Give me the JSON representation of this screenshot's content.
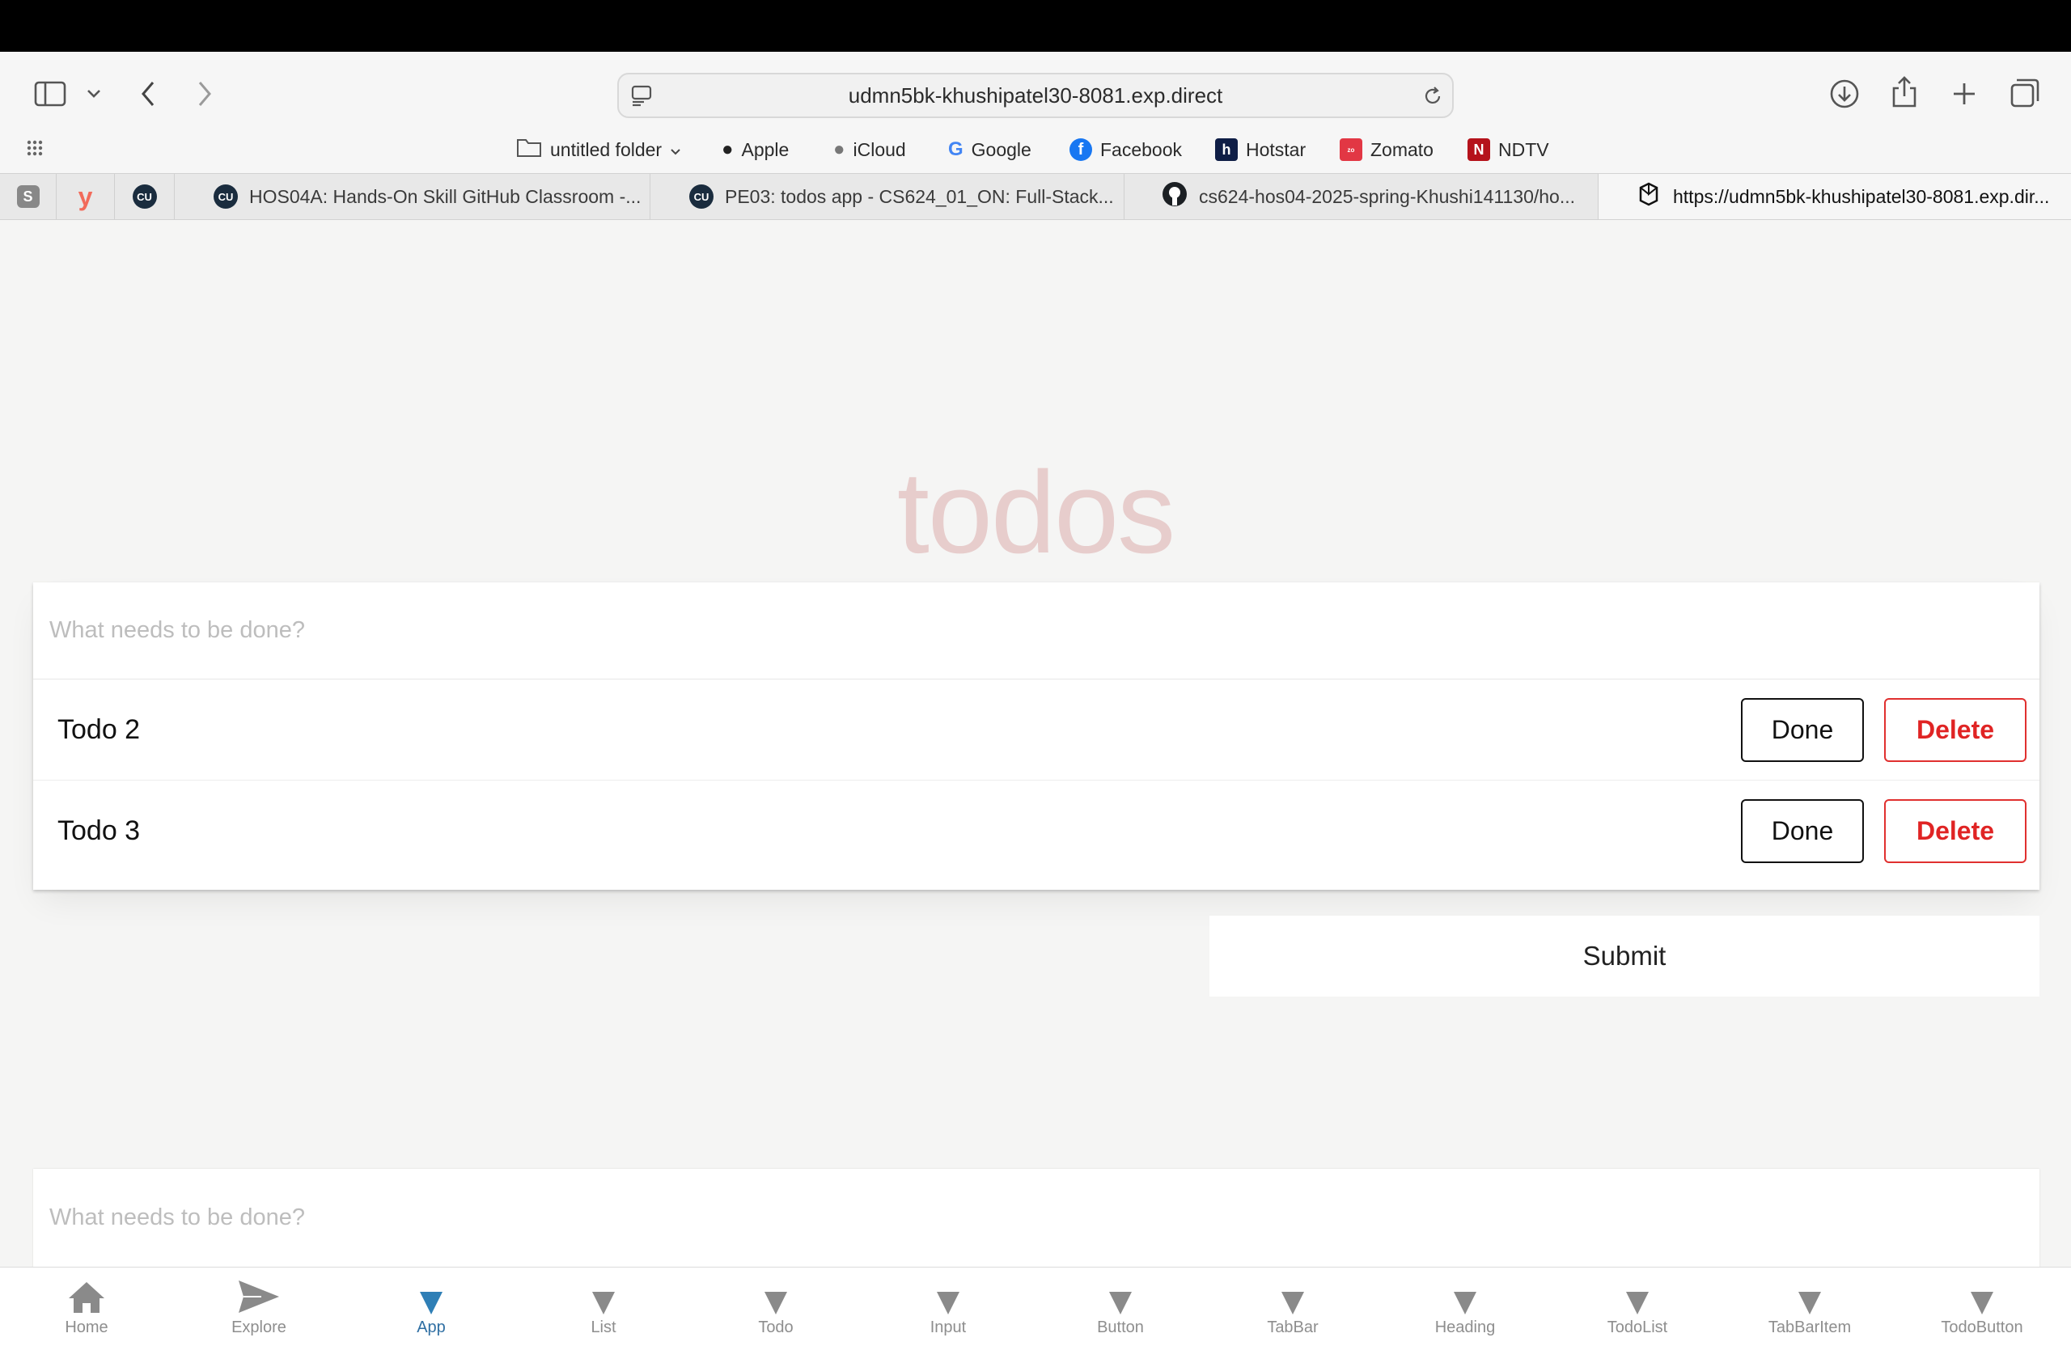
{
  "browser": {
    "url": "udmn5bk-khushipatel30-8081.exp.direct",
    "bookmarks": [
      {
        "label": "untitled folder",
        "icon": "folder-icon"
      },
      {
        "label": "Apple",
        "icon": "apple-icon"
      },
      {
        "label": "iCloud",
        "icon": "apple-icon"
      },
      {
        "label": "Google",
        "icon": "google-icon"
      },
      {
        "label": "Facebook",
        "icon": "facebook-icon"
      },
      {
        "label": "Hotstar",
        "icon": "hotstar-icon"
      },
      {
        "label": "Zomato",
        "icon": "zomato-icon"
      },
      {
        "label": "NDTV",
        "icon": "ndtv-icon"
      }
    ],
    "pinned_tabs": [
      {
        "label": "S"
      },
      {
        "icon": "yc-icon"
      },
      {
        "label": "CU"
      }
    ],
    "tabs": [
      {
        "title": "HOS04A: Hands-On Skill GitHub Classroom -...",
        "icon_label": "CU"
      },
      {
        "title": "PE03: todos app - CS624_01_ON: Full-Stack...",
        "icon_label": "CU"
      },
      {
        "title": "cs624-hos04-2025-spring-Khushi141130/ho...",
        "icon": "github-icon"
      },
      {
        "title": "https://udmn5bk-khushipatel30-8081.exp.dir...",
        "icon": "expo-icon",
        "active": true
      }
    ]
  },
  "app": {
    "title": "todos",
    "input_placeholder": "What needs to be done?",
    "todos": [
      {
        "text": "Todo 2",
        "done_label": "Done",
        "delete_label": "Delete"
      },
      {
        "text": "Todo 3",
        "done_label": "Done",
        "delete_label": "Delete"
      }
    ],
    "submit_label": "Submit",
    "second_input_placeholder": "What needs to be done?"
  },
  "tabbar": {
    "items": [
      {
        "label": "Home",
        "icon": "home-icon"
      },
      {
        "label": "Explore",
        "icon": "send-icon"
      },
      {
        "label": "App",
        "icon": "triangle-down-icon",
        "active": true
      },
      {
        "label": "List",
        "icon": "triangle-down-icon"
      },
      {
        "label": "Todo",
        "icon": "triangle-down-icon"
      },
      {
        "label": "Input",
        "icon": "triangle-down-icon"
      },
      {
        "label": "Button",
        "icon": "triangle-down-icon"
      },
      {
        "label": "TabBar",
        "icon": "triangle-down-icon"
      },
      {
        "label": "Heading",
        "icon": "triangle-down-icon"
      },
      {
        "label": "TodoList",
        "icon": "triangle-down-icon"
      },
      {
        "label": "TabBarItem",
        "icon": "triangle-down-icon"
      },
      {
        "label": "TodoButton",
        "icon": "triangle-down-icon"
      }
    ]
  },
  "colors": {
    "title": "#e6c8c8",
    "delete": "#e02424",
    "active_tab": "#2f7fb6"
  }
}
